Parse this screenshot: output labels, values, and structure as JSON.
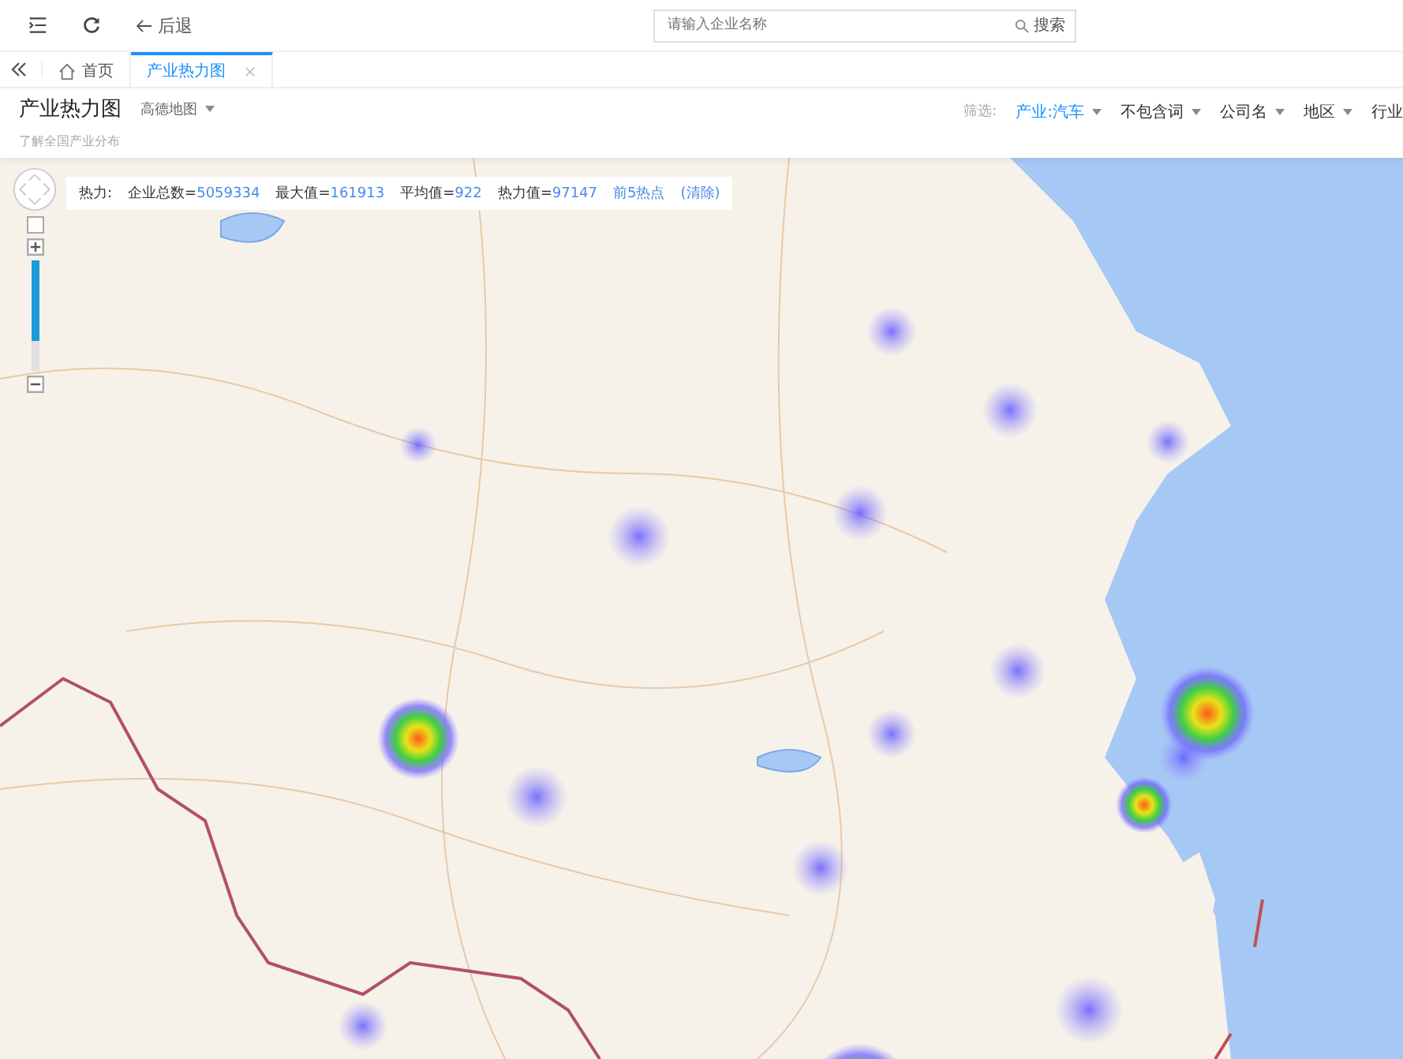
{
  "toolbar": {
    "back_label": "后退",
    "search": {
      "placeholder": "请输入企业名称",
      "button": "搜索"
    }
  },
  "tabs": [
    {
      "label": "首页",
      "kind": "home",
      "selected": false
    },
    {
      "label": "产业热力图",
      "kind": "page",
      "selected": true
    }
  ],
  "header": {
    "title": "产业热力图",
    "map_source": "高德地图",
    "subtitle": "了解全国产业分布",
    "filter_label": "筛选:",
    "filters": [
      {
        "label": "产业:汽车",
        "selected": true
      },
      {
        "label": "不包含词",
        "selected": false
      },
      {
        "label": "公司名",
        "selected": false
      },
      {
        "label": "地区",
        "selected": false
      },
      {
        "label": "行业",
        "selected": false
      }
    ]
  },
  "heat_stats": {
    "label": "热力:",
    "items": [
      {
        "name": "企业总数=",
        "value": "5059334"
      },
      {
        "name": "最大值=",
        "value": "161913"
      },
      {
        "name": "平均值=",
        "value": "922"
      },
      {
        "name": "热力值=",
        "value": "97147"
      }
    ],
    "links": [
      "前5热点",
      "(清除)"
    ]
  },
  "zoom": {
    "level": 0.73
  }
}
